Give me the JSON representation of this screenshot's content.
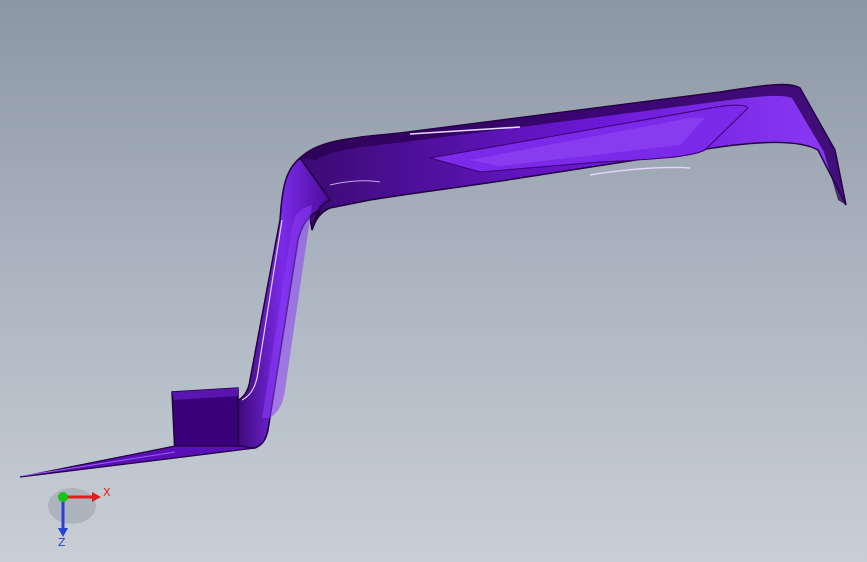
{
  "viewport": {
    "background_top": "#8c97a4",
    "background_bottom": "#c9cfd6"
  },
  "model": {
    "name": "purple-bracket-part",
    "color": "#6a10c8",
    "shadow_color": "#2a0048",
    "highlight_color": "#c9a6ff"
  },
  "triad": {
    "x_label": "X",
    "z_label": "Z",
    "x_color": "#e11d1d",
    "y_color": "#19c419",
    "z_color": "#2a3fd6"
  }
}
